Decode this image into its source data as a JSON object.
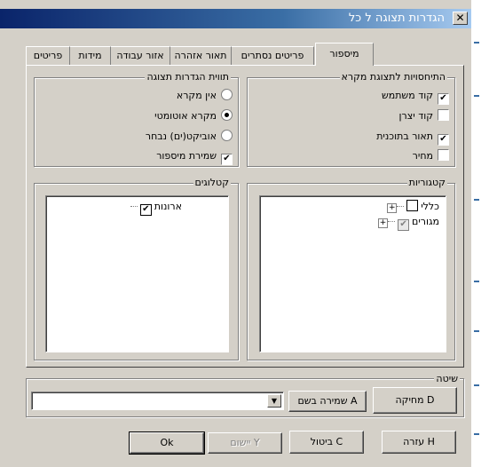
{
  "window": {
    "title": "הגדרות תצוגה ל כל",
    "close_glyph": "✕"
  },
  "tabs": [
    {
      "label": "מיספור"
    },
    {
      "label": "פריטים נסתרים"
    },
    {
      "label": "תאור אזהרה"
    },
    {
      "label": "אזור עבודה"
    },
    {
      "label": "מידות"
    },
    {
      "label": "פריטים"
    }
  ],
  "legend_refs": {
    "title": "התיחסויות לתצוגת מקרא",
    "items": [
      {
        "label": "קוד משתמש",
        "checked": true
      },
      {
        "label": "קוד יצרן",
        "checked": false
      },
      {
        "label": "תאור בתוכנית",
        "checked": true
      },
      {
        "label": "מחיר",
        "checked": false
      }
    ]
  },
  "display_props": {
    "title": "תווית הגדרות תצוגה",
    "radios": [
      {
        "label": "אין מקרא",
        "selected": false
      },
      {
        "label": "מקרא אוטומטי",
        "selected": true
      },
      {
        "label": "אוביקט(ים) נבחר",
        "selected": false
      }
    ],
    "save_numbering": {
      "label": "שמירת מיספור",
      "checked": true
    }
  },
  "categories": {
    "title": "קטגוריות",
    "items": [
      {
        "label": "כללי",
        "checked": false,
        "expander": "+"
      },
      {
        "label": "מגורים",
        "checked": true,
        "grayed": true,
        "expander": "+"
      }
    ]
  },
  "catalogs": {
    "title": "קטלוגים",
    "items": [
      {
        "label": "ארונות",
        "checked": true
      }
    ]
  },
  "method": {
    "title": "שיטה",
    "combo_value": "",
    "save_as_label": "שמירה בשם A",
    "delete_label": "מחיקה D"
  },
  "footer": {
    "ok_label": "Ok",
    "apply_label": "יישום Y",
    "cancel_label": "ביטול C",
    "help_label": "עזרה H"
  },
  "check_glyph": "✔"
}
